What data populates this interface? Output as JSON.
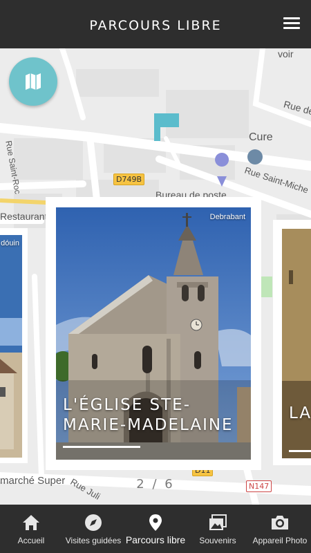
{
  "header": {
    "title": "PARCOURS LIBRE"
  },
  "map": {
    "labels": {
      "cure": "Cure",
      "rue_de": "Rue de",
      "rue_saint_roc": "Rue Saint-Roc",
      "rue_saint_michel": "Rue Saint-Miche",
      "bureau_poste": "Bureau de poste",
      "restaurant": "Restaurant",
      "marche_super": "marché Super",
      "rue_juli": "Rue Juli",
      "avoir": "voir"
    },
    "route_badges": {
      "d749b": "D749B",
      "n147": "N147",
      "d11": "D11"
    }
  },
  "carousel": {
    "current_card": {
      "credit": "Debrabant",
      "title": "L'église Ste-Marie-Madelaine"
    },
    "left_card": {
      "credit": "dóuin"
    },
    "right_card": {
      "title": "La ta"
    },
    "pager": "2 / 6"
  },
  "bottom_nav": {
    "items": [
      {
        "label": "Accueil",
        "icon": "home-icon"
      },
      {
        "label": "Visites guidées",
        "icon": "compass-icon"
      },
      {
        "label": "Parcours libre",
        "icon": "location-pin-icon",
        "active": true
      },
      {
        "label": "Souvenirs",
        "icon": "photos-icon"
      },
      {
        "label": "Appareil Photo",
        "icon": "camera-icon"
      }
    ]
  },
  "colors": {
    "header_bg": "#2e2e2e",
    "map_button": "#6fc3cb",
    "nav_bg": "#2e2e2e"
  }
}
